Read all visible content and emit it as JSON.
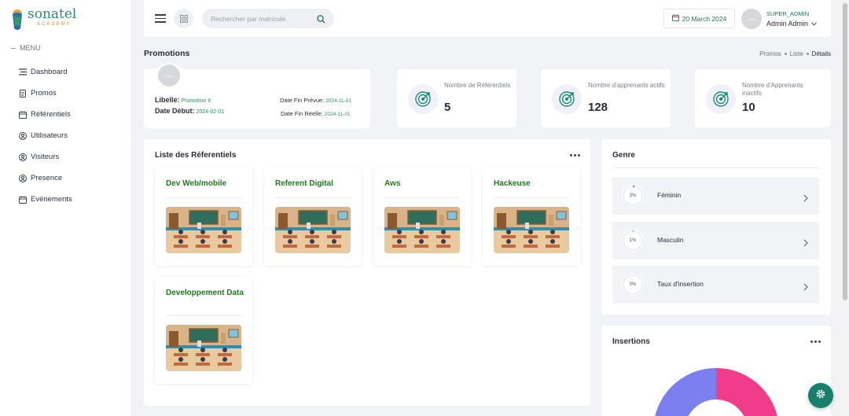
{
  "brand": {
    "name": "sonatel",
    "sub": "ACADEMY"
  },
  "sidebar": {
    "menu_label": "MENU",
    "items": [
      {
        "label": "Dashboard",
        "icon": "dashboard-icon"
      },
      {
        "label": "Promos",
        "icon": "document-icon"
      },
      {
        "label": "Référentiels",
        "icon": "calendar-icon"
      },
      {
        "label": "Utilisateurs",
        "icon": "user-icon"
      },
      {
        "label": "Visiteurs",
        "icon": "user-icon"
      },
      {
        "label": "Presence",
        "icon": "user-icon"
      },
      {
        "label": "Evénements",
        "icon": "calendar-icon"
      }
    ]
  },
  "topbar": {
    "search_placeholder": "Rechercher par matricule",
    "date": "20 March 2024",
    "avatar_text": "avatar",
    "user_role": "SUPER_ADMIN",
    "user_name": "Admin Admin"
  },
  "page": {
    "title": "Promotions",
    "breadcrumb": [
      "Promos",
      "Liste",
      "Détails"
    ]
  },
  "promo": {
    "avatar_text": "avatar",
    "libelle_label": "Libelle:",
    "libelle_value": "Promotion 6",
    "debut_label": "Date Début:",
    "debut_value": "2024-02-01",
    "fin_prevue_label": "Date Fin Prévue:",
    "fin_prevue_value": "2024-11-01",
    "fin_reelle_label": "Date Fin Réelle:",
    "fin_reelle_value": "2024-11-01"
  },
  "stats": [
    {
      "label": "Nombre de Référentiels",
      "value": "5"
    },
    {
      "label": "Nombre d'apprenants actifs",
      "value": "128"
    },
    {
      "label": "Nombre d'Apprenants inactifs",
      "value": "10"
    }
  ],
  "referentiels": {
    "title": "Liste des Réferentiels",
    "items": [
      {
        "title": "Dev Web/mobile"
      },
      {
        "title": "Referent Digital"
      },
      {
        "title": "Aws"
      },
      {
        "title": "Hackeuse"
      },
      {
        "title": "Developpement Data"
      }
    ]
  },
  "genre": {
    "title": "Genre",
    "rows": [
      {
        "label": "Féminin",
        "percent": "3%"
      },
      {
        "label": "Masculin",
        "percent": "1%"
      },
      {
        "label": "Taux d'insertion",
        "percent": "0%"
      }
    ]
  },
  "insertions": {
    "title": "Insertions",
    "colors": [
      "#f13c8b",
      "#7b7ff0"
    ]
  },
  "colors": {
    "accent": "#17806d",
    "link_green": "#2a8a6e",
    "ref_title": "#1f7a1f"
  }
}
